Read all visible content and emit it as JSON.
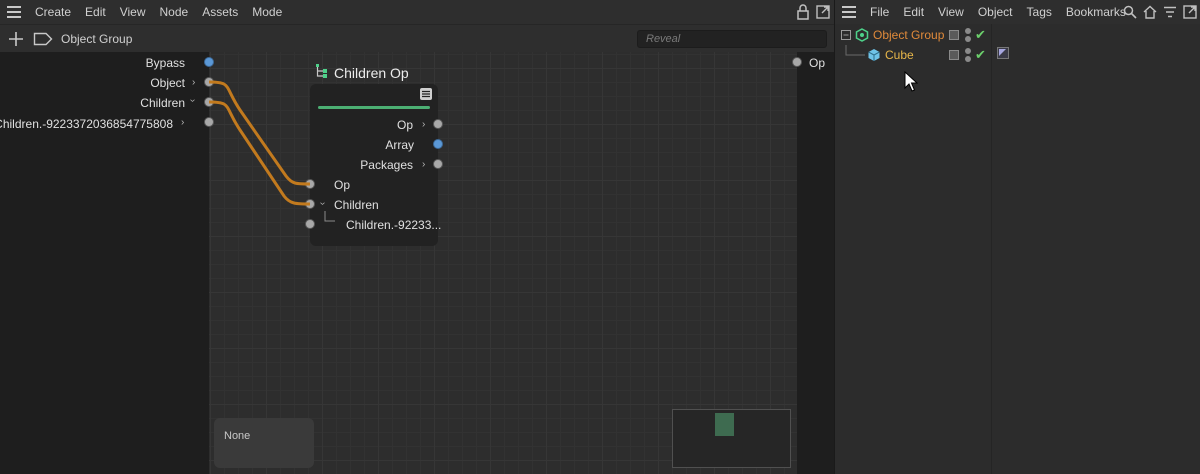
{
  "node_editor": {
    "menu": [
      "Create",
      "Edit",
      "View",
      "Node",
      "Assets",
      "Mode"
    ],
    "breadcrumb": "Object Group",
    "reveal_placeholder": "Reveal",
    "inputs": {
      "bypass": "Bypass",
      "object": "Object",
      "children": "Children",
      "children_sub": "Children.-9223372036854775808"
    },
    "outputs": {
      "op": "Op"
    },
    "node": {
      "title": "Children Op",
      "out_op": "Op",
      "out_array": "Array",
      "out_packages": "Packages",
      "in_op": "Op",
      "in_children": "Children",
      "in_children_sub": "Children.-92233..."
    },
    "info_box": "None"
  },
  "object_manager": {
    "menu": [
      "File",
      "Edit",
      "View",
      "Object",
      "Tags",
      "Bookmarks"
    ],
    "objects": [
      {
        "name": "Object Group"
      },
      {
        "name": "Cube"
      }
    ]
  },
  "colors": {
    "wire": "#c27a1e",
    "accent_green": "#4caf73",
    "orange_text": "#e08a3a"
  }
}
